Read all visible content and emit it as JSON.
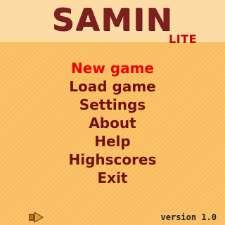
{
  "title": "SAMIN",
  "subtitle": "LITE",
  "menu": {
    "items": [
      {
        "label": "New game",
        "selected": true
      },
      {
        "label": "Load game"
      },
      {
        "label": "Settings"
      },
      {
        "label": "About"
      },
      {
        "label": "Help"
      },
      {
        "label": "Highscores"
      },
      {
        "label": "Exit"
      }
    ]
  },
  "footer": {
    "logo_icon": "back-softkey-icon",
    "version": "version 1.0"
  },
  "colors": {
    "background": "#f9bd5f",
    "header_band": "#fcdba5",
    "title": "#7e2020",
    "subtitle": "#c90000",
    "menu_item": "#6e1010",
    "menu_selected": "#ee0000"
  }
}
